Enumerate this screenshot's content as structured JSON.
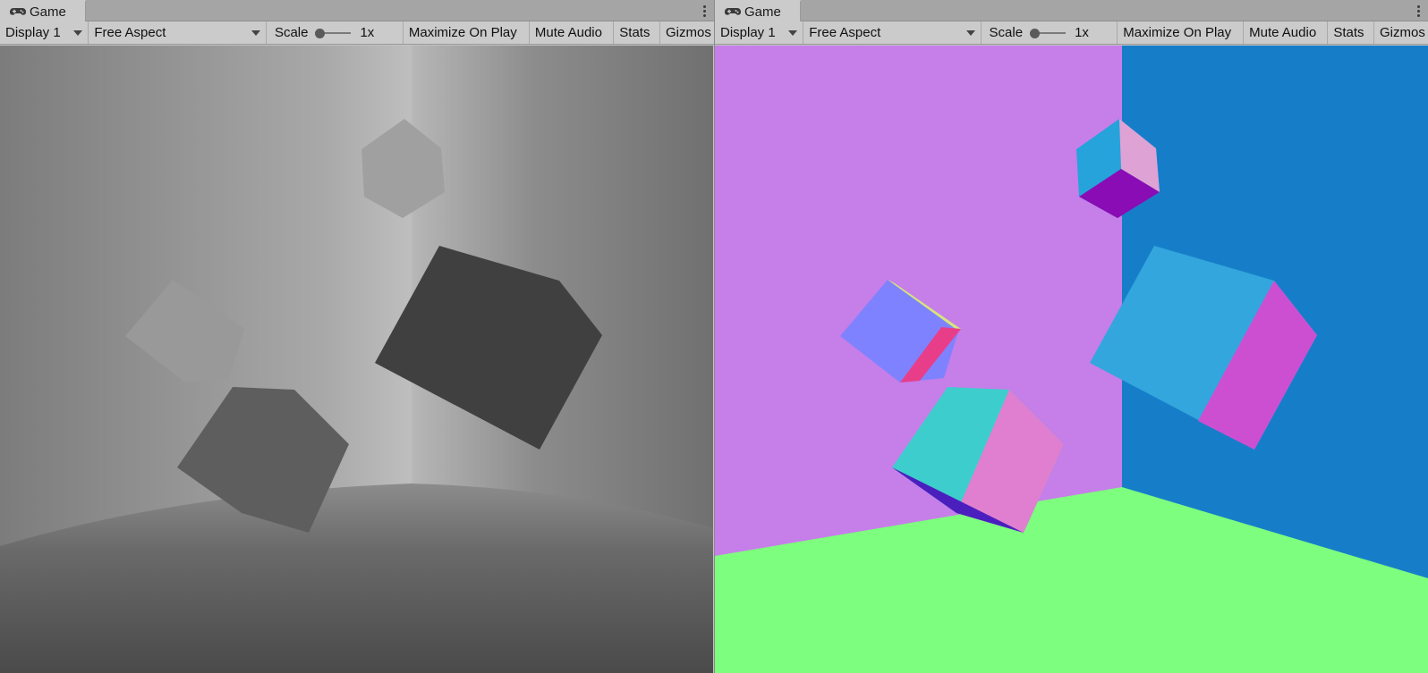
{
  "panels": [
    {
      "tab_title": "Game",
      "tab_icon": "gamepad-icon",
      "toolbar": {
        "display": "Display 1",
        "aspect": "Free Aspect",
        "scale_label": "Scale",
        "scale_value": "1x",
        "maximize": "Maximize On Play",
        "mute": "Mute Audio",
        "stats": "Stats",
        "gizmos": "Gizmos"
      },
      "view": "depth-view"
    },
    {
      "tab_title": "Game",
      "tab_icon": "gamepad-icon",
      "toolbar": {
        "display": "Display 1",
        "aspect": "Free Aspect",
        "scale_label": "Scale",
        "scale_value": "1x",
        "maximize": "Maximize On Play",
        "mute": "Mute Audio",
        "stats": "Stats",
        "gizmos": "Gizmos"
      },
      "view": "normals-view"
    }
  ],
  "colors": {
    "editor_bg": "#c2c2c2",
    "tab_active": "#cbcbcb",
    "normals_left_wall": "#c67ee9",
    "normals_right_wall": "#167ec9",
    "normals_floor": "#7efe7e"
  }
}
